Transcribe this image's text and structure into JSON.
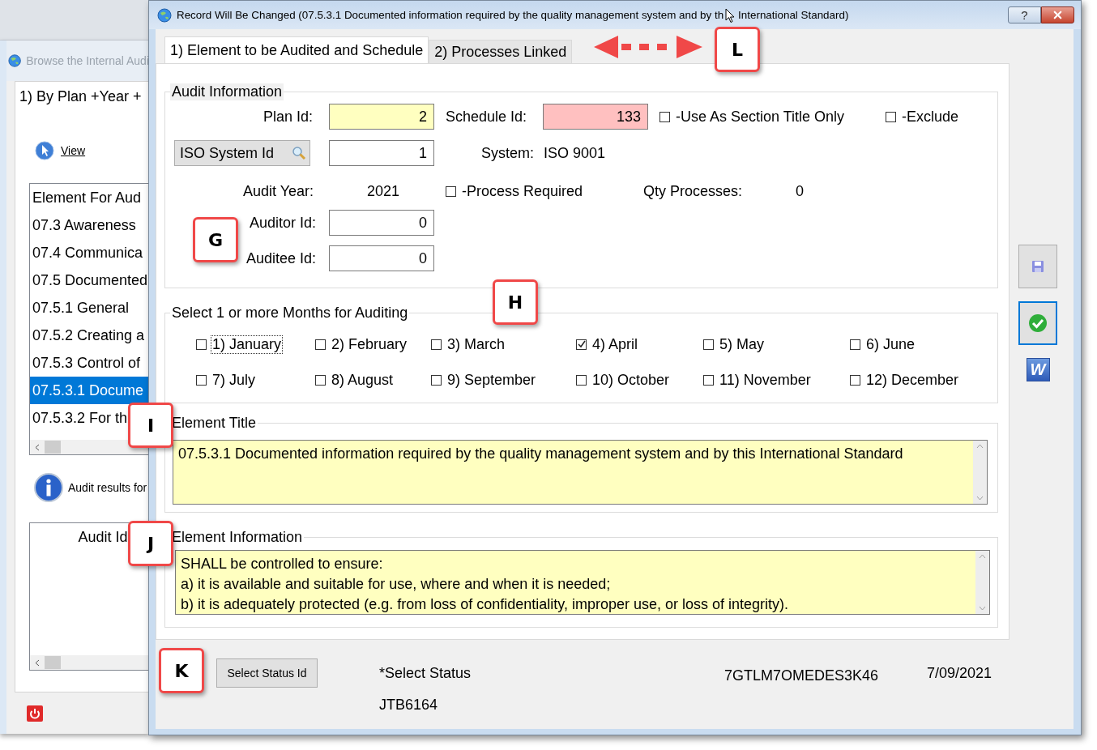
{
  "background_window": {
    "title": "Browse the Internal Audi",
    "tab": "1) By Plan +Year +",
    "view_link": "View",
    "element_list": {
      "header": "Element For Aud",
      "rows": [
        {
          "text": "07.3 Awareness",
          "selected": false
        },
        {
          "text": "07.4 Communica",
          "selected": false
        },
        {
          "text": "07.5 Documented",
          "selected": false
        },
        {
          "text": "07.5.1 General",
          "selected": false
        },
        {
          "text": "07.5.2 Creating a",
          "selected": false
        },
        {
          "text": "07.5.3 Control of",
          "selected": false
        },
        {
          "text": "07.5.3.1 Docume",
          "selected": true
        },
        {
          "text": "07.5.3.2 For th",
          "selected": false
        }
      ]
    },
    "info_text": "Audit results for",
    "audit_list": {
      "header": "Audit Id"
    }
  },
  "dialog": {
    "title": "Record Will Be Changed  (07.5.3.1 Documented information required by the quality management system and by th",
    "title_rest": "International Standard)",
    "help_button": "?",
    "tabs": [
      {
        "label": "1) Element to be Audited and Schedule",
        "selected": true
      },
      {
        "label": "2) Processes Linked",
        "selected": false
      }
    ],
    "audit_information": {
      "legend": "Audit Information",
      "plan_id": {
        "label": "Plan Id:",
        "value": "2",
        "color": "#ffffc0"
      },
      "schedule_id": {
        "label": "Schedule Id:",
        "value": "133",
        "color": "#ffc0c0"
      },
      "section_title_only": {
        "label": "-Use As Section Title Only",
        "checked": false
      },
      "exclude": {
        "label": "-Exclude",
        "checked": false
      },
      "iso_system_button": "ISO System Id",
      "iso_system_id": {
        "value": "1",
        "color": "#ffffff"
      },
      "system": {
        "label": "System:",
        "value": "ISO 9001"
      },
      "audit_year": {
        "label": "Audit Year:",
        "value": "2021"
      },
      "process_required": {
        "label": "-Process Required",
        "checked": false
      },
      "qty_processes": {
        "label": "Qty Processes:",
        "value": "0"
      },
      "auditor_id": {
        "label": "Auditor Id:",
        "value": "0",
        "color": "#ffffff"
      },
      "auditee_id": {
        "label": "Auditee Id:",
        "value": "0",
        "color": "#ffffff"
      }
    },
    "months": {
      "legend": "Select 1 or more Months for Auditing",
      "items": [
        {
          "label": "1) January",
          "checked": false,
          "focused": true
        },
        {
          "label": "2) February",
          "checked": false,
          "focused": false
        },
        {
          "label": "3) March",
          "checked": false,
          "focused": false
        },
        {
          "label": "4) April",
          "checked": true,
          "focused": false
        },
        {
          "label": "5) May",
          "checked": false,
          "focused": false
        },
        {
          "label": "6) June",
          "checked": false,
          "focused": false
        },
        {
          "label": "7) July",
          "checked": false,
          "focused": false
        },
        {
          "label": "8) August",
          "checked": false,
          "focused": false
        },
        {
          "label": "9) September",
          "checked": false,
          "focused": false
        },
        {
          "label": "10) October",
          "checked": false,
          "focused": false
        },
        {
          "label": "11) November",
          "checked": false,
          "focused": false
        },
        {
          "label": "12) December",
          "checked": false,
          "focused": false
        }
      ]
    },
    "element_title": {
      "legend": "Element Title",
      "value": "07.5.3.1 Documented information required by the quality management system and by this International Standard"
    },
    "element_information": {
      "legend": "Element Information",
      "value": "SHALL be controlled to ensure:\na) it is available and suitable for use, where and when it is needed;\nb) it is adequately protected (e.g. from loss of confidentiality, improper use, or loss of integrity)."
    },
    "toolbar": [
      {
        "kind": "save",
        "focused": false
      },
      {
        "kind": "confirm",
        "focused": true
      },
      {
        "kind": "word",
        "label": "W",
        "focused": false
      }
    ],
    "footer": {
      "status_button": "Select Status Id",
      "status_label": "*Select Status",
      "user": "JTB6164",
      "code": "7GTLM7OMEDES3K46",
      "date": "7/09/2021"
    }
  },
  "callouts": [
    {
      "label": "L"
    },
    {
      "label": "G"
    },
    {
      "label": "H"
    },
    {
      "label": "I"
    },
    {
      "label": "J"
    },
    {
      "label": "K"
    }
  ]
}
